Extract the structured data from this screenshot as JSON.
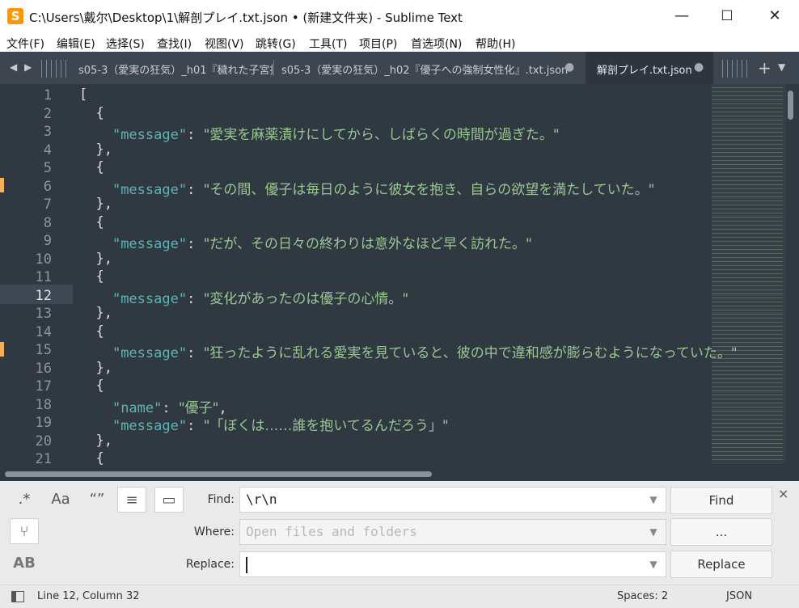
{
  "window": {
    "title": "C:\\Users\\戴尔\\Desktop\\1\\解剖プレイ.txt.json • (新建文件夹) - Sublime Text",
    "minimize": "—",
    "maximize": "☐",
    "close": "✕"
  },
  "menu": [
    "文件(F)",
    "编辑(E)",
    "选择(S)",
    "查找(I)",
    "视图(V)",
    "跳转(G)",
    "工具(T)",
    "项目(P)",
    "首选项(N)",
    "帮助(H)"
  ],
  "tabs": [
    {
      "label": "s05-3（愛実の狂気）_h01『穢れた子宮捕"
    },
    {
      "label": "s05-3（愛実の狂気）_h02『優子への強制女性化』.txt.json",
      "dot": "●"
    },
    {
      "label": "解剖プレイ.txt.json",
      "dot": "●"
    }
  ],
  "tabbar": {
    "left": "◀",
    "right": "▶",
    "add": "+",
    "menu": "▼"
  },
  "editor": {
    "line_numbers": [
      "1",
      "2",
      "3",
      "4",
      "5",
      "6",
      "7",
      "8",
      "9",
      "10",
      "11",
      "12",
      "13",
      "14",
      "15",
      "16",
      "17",
      "18",
      "19",
      "20",
      "21"
    ],
    "active_line": "12",
    "lines": [
      {
        "indent": "",
        "text": "["
      },
      {
        "indent": "  ",
        "text": "{"
      },
      {
        "indent": "    ",
        "key": "\"message\"",
        "value": "\"愛実を麻薬漬けにしてから、しばらくの時間が過ぎた。\""
      },
      {
        "indent": "  ",
        "text": "},"
      },
      {
        "indent": "  ",
        "text": "{"
      },
      {
        "indent": "    ",
        "key": "\"message\"",
        "value": "\"その間、優子は毎日のように彼女を抱き、自らの欲望を満たしていた。\""
      },
      {
        "indent": "  ",
        "text": "},"
      },
      {
        "indent": "  ",
        "text": "{"
      },
      {
        "indent": "    ",
        "key": "\"message\"",
        "value": "\"だが、その日々の終わりは意外なほど早く訪れた。\""
      },
      {
        "indent": "  ",
        "text": "},"
      },
      {
        "indent": "  ",
        "text": "{"
      },
      {
        "indent": "    ",
        "key": "\"message\"",
        "value": "\"変化があったのは優子の心情。\""
      },
      {
        "indent": "  ",
        "text": "},"
      },
      {
        "indent": "  ",
        "text": "{"
      },
      {
        "indent": "    ",
        "key": "\"message\"",
        "value": "\"狂ったように乱れる愛実を見ていると、彼の中で違和感が膨らむようになっていた。\""
      },
      {
        "indent": "  ",
        "text": "},"
      },
      {
        "indent": "  ",
        "text": "{"
      },
      {
        "indent": "    ",
        "key": "\"name\"",
        "value": "\"優子\"",
        "trail": ","
      },
      {
        "indent": "    ",
        "key": "\"message\"",
        "value": "\"「ぼくは……誰を抱いてるんだろう」\""
      },
      {
        "indent": "  ",
        "text": "},"
      },
      {
        "indent": "  ",
        "text": "{"
      }
    ],
    "modified_lines": [
      "6",
      "15"
    ]
  },
  "find_panel": {
    "options": {
      "regex": ".*",
      "case": "Aa",
      "whole_word": "“”",
      "wrap": "≡",
      "in_selection": "▭",
      "use_buffer": "⑂",
      "preserve_case": "AB"
    },
    "find_label": "Find:",
    "find_value": "\\r\\n",
    "where_label": "Where:",
    "where_placeholder": "Open files and folders",
    "replace_label": "Replace:",
    "replace_value": "",
    "find_button": "Find",
    "where_button": "...",
    "replace_button": "Replace",
    "close": "×"
  },
  "status": {
    "position": "Line 12, Column 32",
    "spaces": "Spaces: 2",
    "syntax": "JSON"
  },
  "colors": {
    "accent": "#f9ae58",
    "editor_bg": "#303841",
    "string": "#99c794",
    "key": "#5fb4b4"
  }
}
